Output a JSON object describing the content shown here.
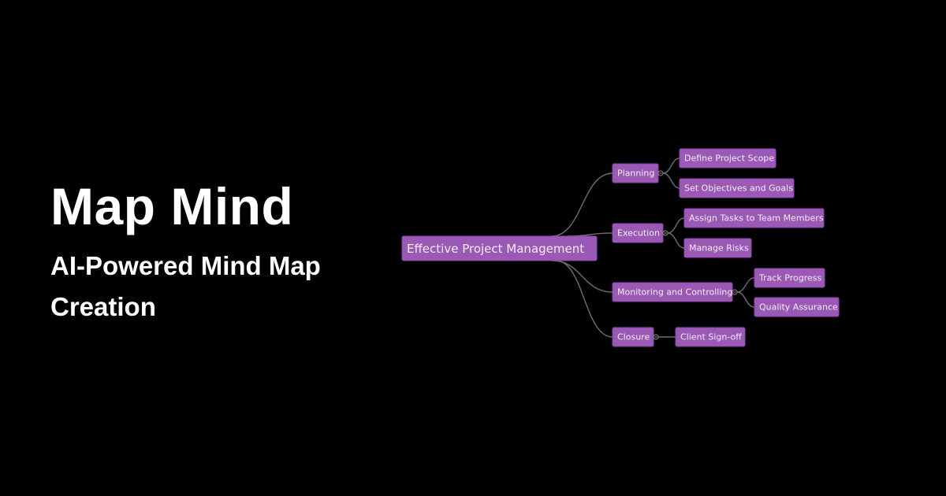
{
  "hero": {
    "title": "Map Mind",
    "subtitle": "AI-Powered Mind Map Creation"
  },
  "colors": {
    "background": "#000000",
    "node_fill": "#9b59b6",
    "node_text": "#f4ecf7",
    "link": "#6e6e6e",
    "hero_text": "#ffffff"
  },
  "mindmap": {
    "root": "Effective Project Management",
    "branches": [
      {
        "label": "Planning",
        "children": [
          "Define Project Scope",
          "Set Objectives and Goals"
        ]
      },
      {
        "label": "Execution",
        "children": [
          "Assign Tasks to Team Members",
          "Manage Risks"
        ]
      },
      {
        "label": "Monitoring and Controlling",
        "children": [
          "Track Progress",
          "Quality Assurance"
        ]
      },
      {
        "label": "Closure",
        "children": [
          "Client Sign-off"
        ]
      }
    ]
  }
}
